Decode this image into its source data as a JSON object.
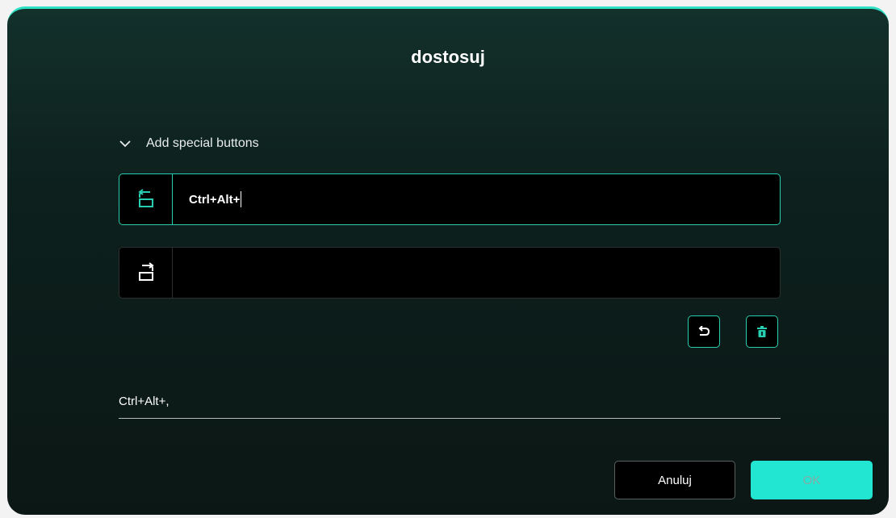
{
  "dialog": {
    "title": "dostosuj",
    "section_label": "Add special buttons",
    "rows": [
      {
        "value": "Ctrl+Alt+",
        "icon": "rotate-counterclockwise-icon"
      },
      {
        "value": "",
        "icon": "rotate-clockwise-icon"
      }
    ],
    "summary": "Ctrl+Alt+,",
    "cancel_label": "Anuluj",
    "ok_label": "OK"
  },
  "colors": {
    "accent": "#27cdb0",
    "ok_button": "#22e6d1",
    "background": "#0d201d"
  }
}
